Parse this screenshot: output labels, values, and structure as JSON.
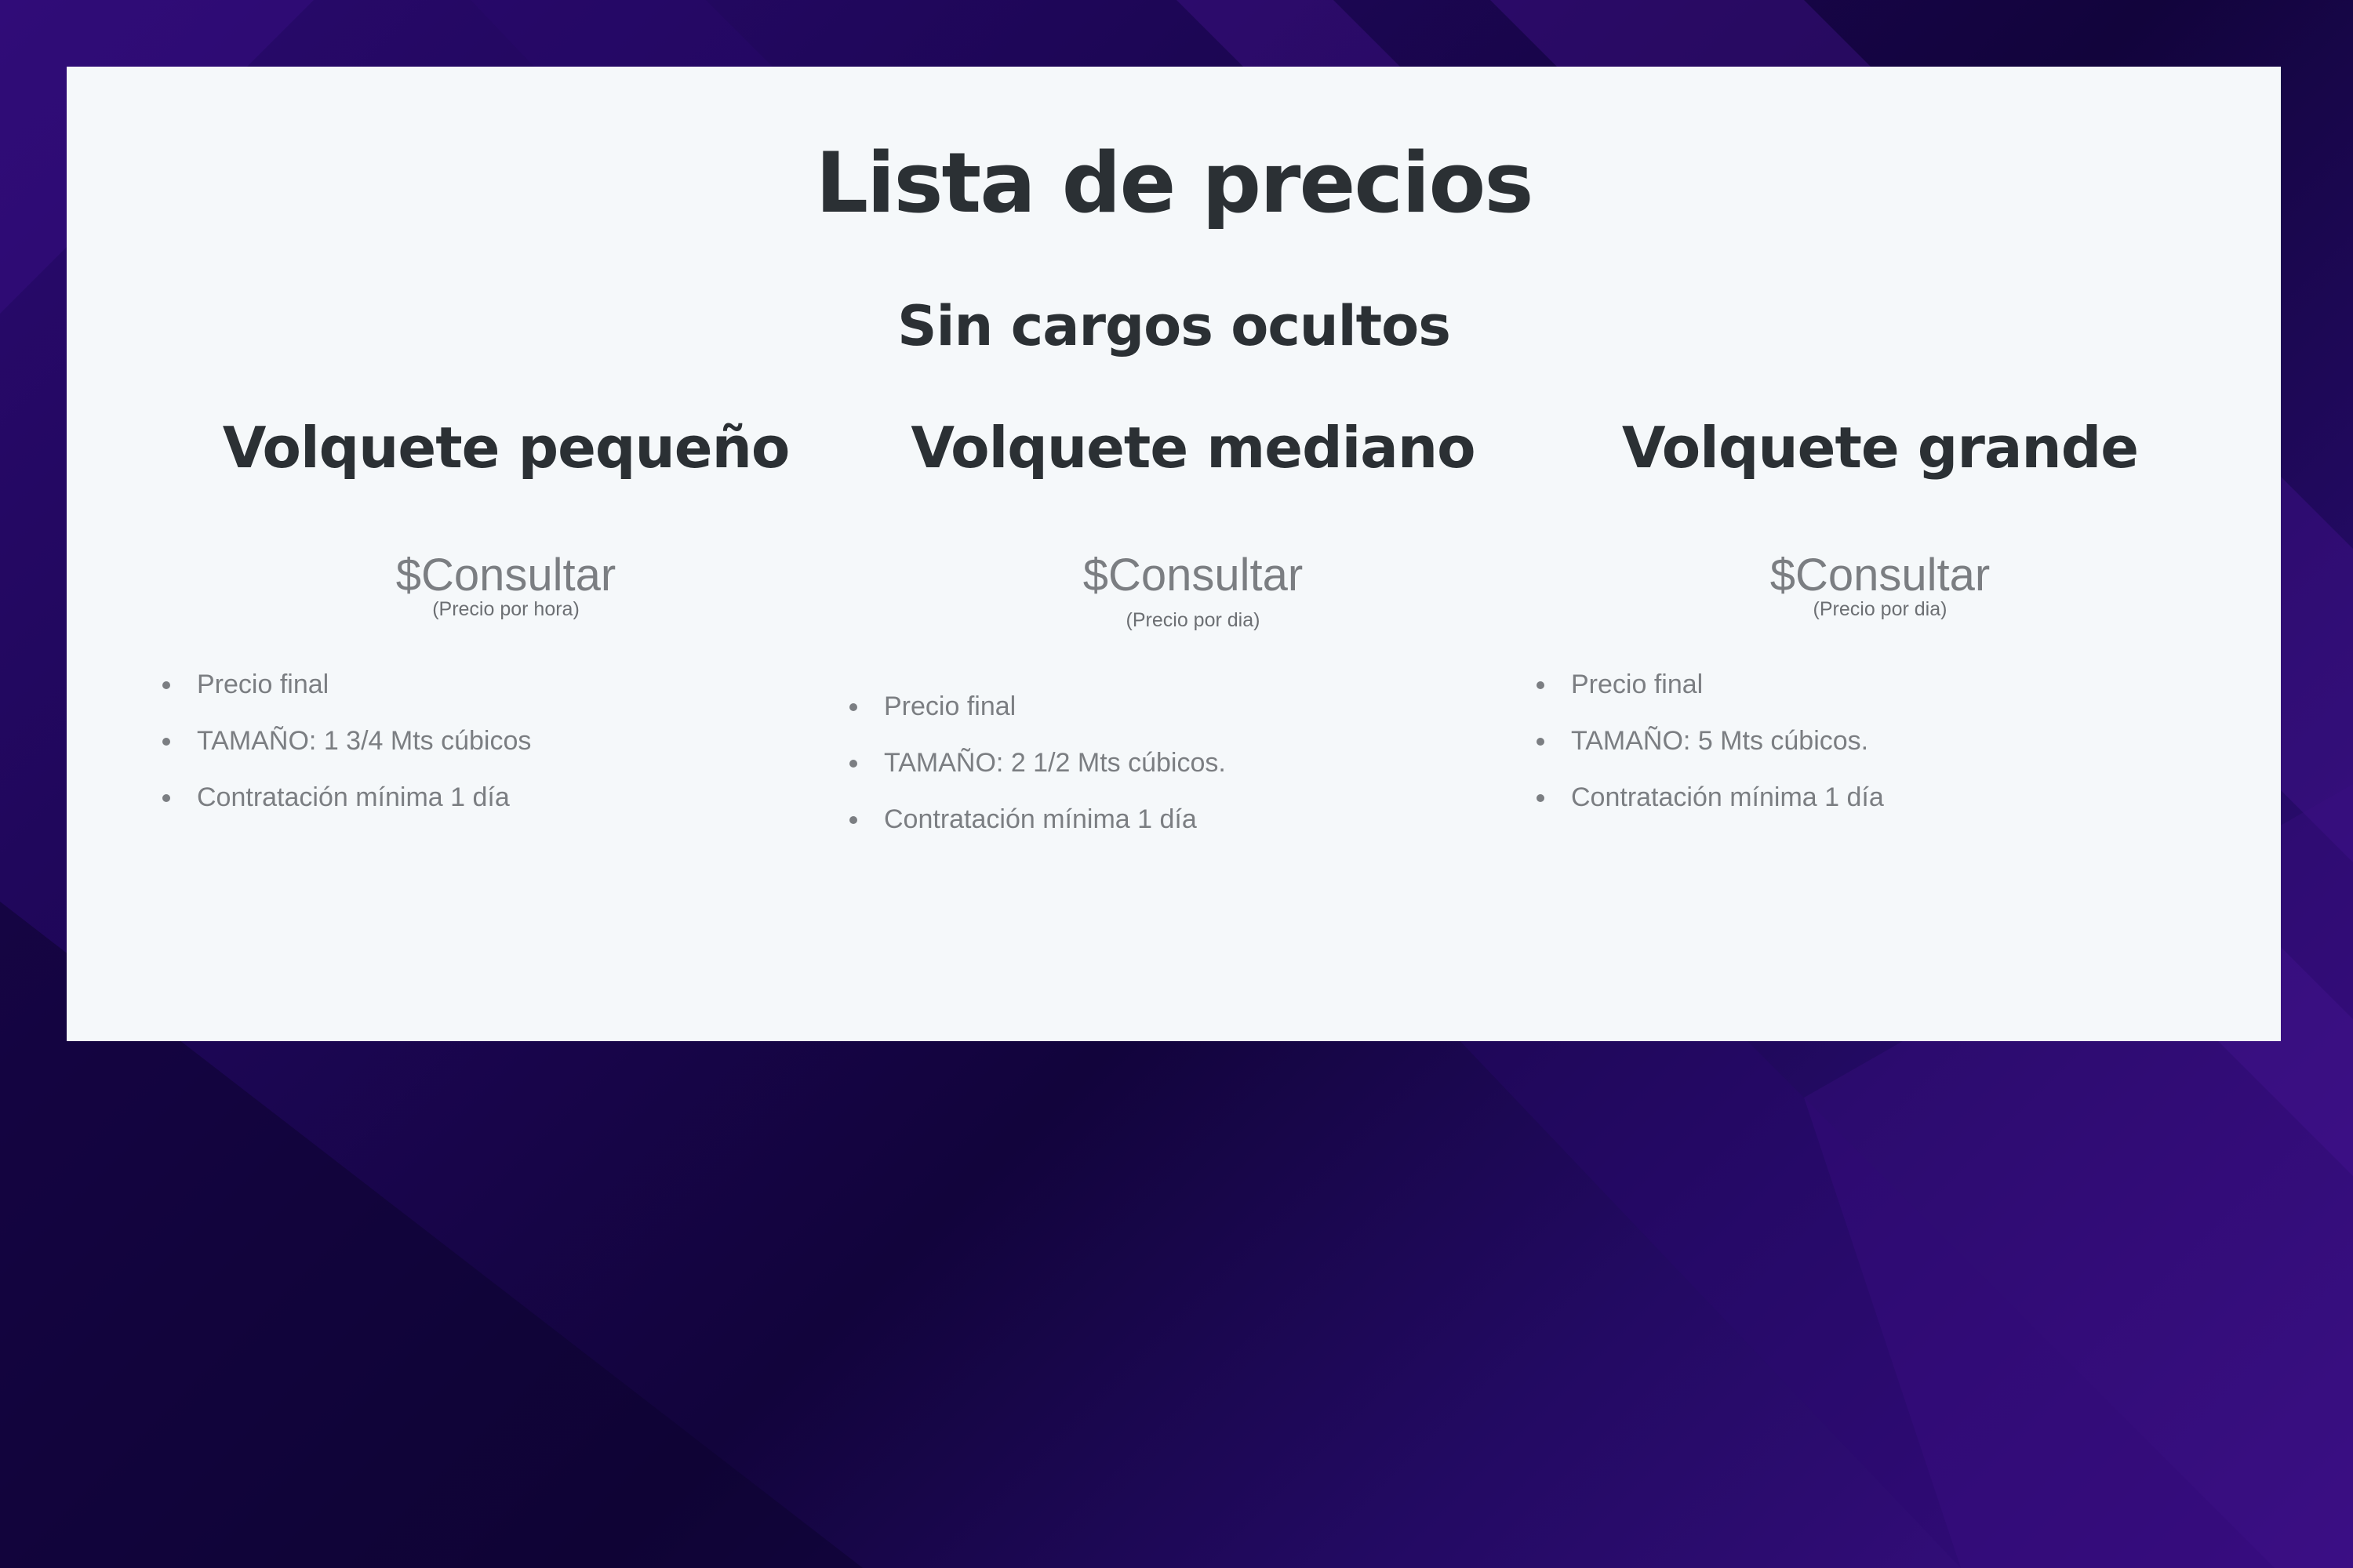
{
  "page": {
    "title": "Lista de precios",
    "subtitle": "Sin cargos ocultos"
  },
  "plans": [
    {
      "name": "Volquete pequeño",
      "price": "$Consultar",
      "note": "(Precio por hora)",
      "features": [
        "Precio final",
        "TAMAÑO: 1 3/4 Mts cúbicos",
        "Contratación mínima 1 día"
      ]
    },
    {
      "name": "Volquete mediano",
      "price": "$Consultar",
      "note": "(Precio por dia)",
      "features": [
        "Precio final",
        "TAMAÑO: 2 1/2 Mts cúbicos.",
        "Contratación mínima 1 día"
      ]
    },
    {
      "name": "Volquete grande",
      "price": "$Consultar",
      "note": "(Precio por dia)",
      "features": [
        "Precio final",
        "TAMAÑO: 5 Mts cúbicos.",
        "Contratación mínima 1 día"
      ]
    }
  ],
  "colors": {
    "panel_background": "#f5f8fa",
    "heading": "#2b3034",
    "muted_text": "#7b7e82",
    "page_background": "#1d0656"
  }
}
